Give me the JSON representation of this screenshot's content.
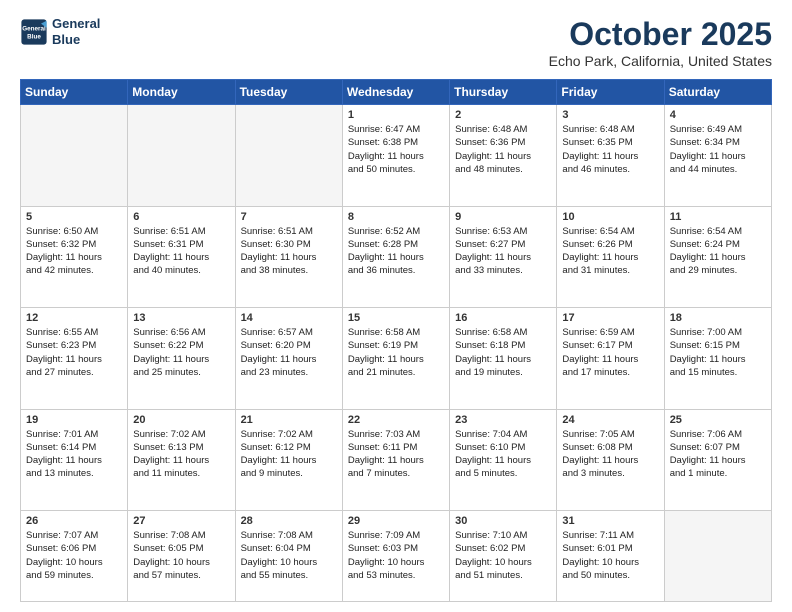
{
  "header": {
    "logo_line1": "General",
    "logo_line2": "Blue",
    "month": "October 2025",
    "location": "Echo Park, California, United States"
  },
  "weekdays": [
    "Sunday",
    "Monday",
    "Tuesday",
    "Wednesday",
    "Thursday",
    "Friday",
    "Saturday"
  ],
  "rows": [
    [
      {
        "day": "",
        "detail": "",
        "empty": true
      },
      {
        "day": "",
        "detail": "",
        "empty": true
      },
      {
        "day": "",
        "detail": "",
        "empty": true
      },
      {
        "day": "1",
        "detail": "Sunrise: 6:47 AM\nSunset: 6:38 PM\nDaylight: 11 hours\nand 50 minutes."
      },
      {
        "day": "2",
        "detail": "Sunrise: 6:48 AM\nSunset: 6:36 PM\nDaylight: 11 hours\nand 48 minutes."
      },
      {
        "day": "3",
        "detail": "Sunrise: 6:48 AM\nSunset: 6:35 PM\nDaylight: 11 hours\nand 46 minutes."
      },
      {
        "day": "4",
        "detail": "Sunrise: 6:49 AM\nSunset: 6:34 PM\nDaylight: 11 hours\nand 44 minutes."
      }
    ],
    [
      {
        "day": "5",
        "detail": "Sunrise: 6:50 AM\nSunset: 6:32 PM\nDaylight: 11 hours\nand 42 minutes."
      },
      {
        "day": "6",
        "detail": "Sunrise: 6:51 AM\nSunset: 6:31 PM\nDaylight: 11 hours\nand 40 minutes."
      },
      {
        "day": "7",
        "detail": "Sunrise: 6:51 AM\nSunset: 6:30 PM\nDaylight: 11 hours\nand 38 minutes."
      },
      {
        "day": "8",
        "detail": "Sunrise: 6:52 AM\nSunset: 6:28 PM\nDaylight: 11 hours\nand 36 minutes."
      },
      {
        "day": "9",
        "detail": "Sunrise: 6:53 AM\nSunset: 6:27 PM\nDaylight: 11 hours\nand 33 minutes."
      },
      {
        "day": "10",
        "detail": "Sunrise: 6:54 AM\nSunset: 6:26 PM\nDaylight: 11 hours\nand 31 minutes."
      },
      {
        "day": "11",
        "detail": "Sunrise: 6:54 AM\nSunset: 6:24 PM\nDaylight: 11 hours\nand 29 minutes."
      }
    ],
    [
      {
        "day": "12",
        "detail": "Sunrise: 6:55 AM\nSunset: 6:23 PM\nDaylight: 11 hours\nand 27 minutes."
      },
      {
        "day": "13",
        "detail": "Sunrise: 6:56 AM\nSunset: 6:22 PM\nDaylight: 11 hours\nand 25 minutes."
      },
      {
        "day": "14",
        "detail": "Sunrise: 6:57 AM\nSunset: 6:20 PM\nDaylight: 11 hours\nand 23 minutes."
      },
      {
        "day": "15",
        "detail": "Sunrise: 6:58 AM\nSunset: 6:19 PM\nDaylight: 11 hours\nand 21 minutes."
      },
      {
        "day": "16",
        "detail": "Sunrise: 6:58 AM\nSunset: 6:18 PM\nDaylight: 11 hours\nand 19 minutes."
      },
      {
        "day": "17",
        "detail": "Sunrise: 6:59 AM\nSunset: 6:17 PM\nDaylight: 11 hours\nand 17 minutes."
      },
      {
        "day": "18",
        "detail": "Sunrise: 7:00 AM\nSunset: 6:15 PM\nDaylight: 11 hours\nand 15 minutes."
      }
    ],
    [
      {
        "day": "19",
        "detail": "Sunrise: 7:01 AM\nSunset: 6:14 PM\nDaylight: 11 hours\nand 13 minutes."
      },
      {
        "day": "20",
        "detail": "Sunrise: 7:02 AM\nSunset: 6:13 PM\nDaylight: 11 hours\nand 11 minutes."
      },
      {
        "day": "21",
        "detail": "Sunrise: 7:02 AM\nSunset: 6:12 PM\nDaylight: 11 hours\nand 9 minutes."
      },
      {
        "day": "22",
        "detail": "Sunrise: 7:03 AM\nSunset: 6:11 PM\nDaylight: 11 hours\nand 7 minutes."
      },
      {
        "day": "23",
        "detail": "Sunrise: 7:04 AM\nSunset: 6:10 PM\nDaylight: 11 hours\nand 5 minutes."
      },
      {
        "day": "24",
        "detail": "Sunrise: 7:05 AM\nSunset: 6:08 PM\nDaylight: 11 hours\nand 3 minutes."
      },
      {
        "day": "25",
        "detail": "Sunrise: 7:06 AM\nSunset: 6:07 PM\nDaylight: 11 hours\nand 1 minute."
      }
    ],
    [
      {
        "day": "26",
        "detail": "Sunrise: 7:07 AM\nSunset: 6:06 PM\nDaylight: 10 hours\nand 59 minutes."
      },
      {
        "day": "27",
        "detail": "Sunrise: 7:08 AM\nSunset: 6:05 PM\nDaylight: 10 hours\nand 57 minutes."
      },
      {
        "day": "28",
        "detail": "Sunrise: 7:08 AM\nSunset: 6:04 PM\nDaylight: 10 hours\nand 55 minutes."
      },
      {
        "day": "29",
        "detail": "Sunrise: 7:09 AM\nSunset: 6:03 PM\nDaylight: 10 hours\nand 53 minutes."
      },
      {
        "day": "30",
        "detail": "Sunrise: 7:10 AM\nSunset: 6:02 PM\nDaylight: 10 hours\nand 51 minutes."
      },
      {
        "day": "31",
        "detail": "Sunrise: 7:11 AM\nSunset: 6:01 PM\nDaylight: 10 hours\nand 50 minutes."
      },
      {
        "day": "",
        "detail": "",
        "empty": true
      }
    ]
  ]
}
